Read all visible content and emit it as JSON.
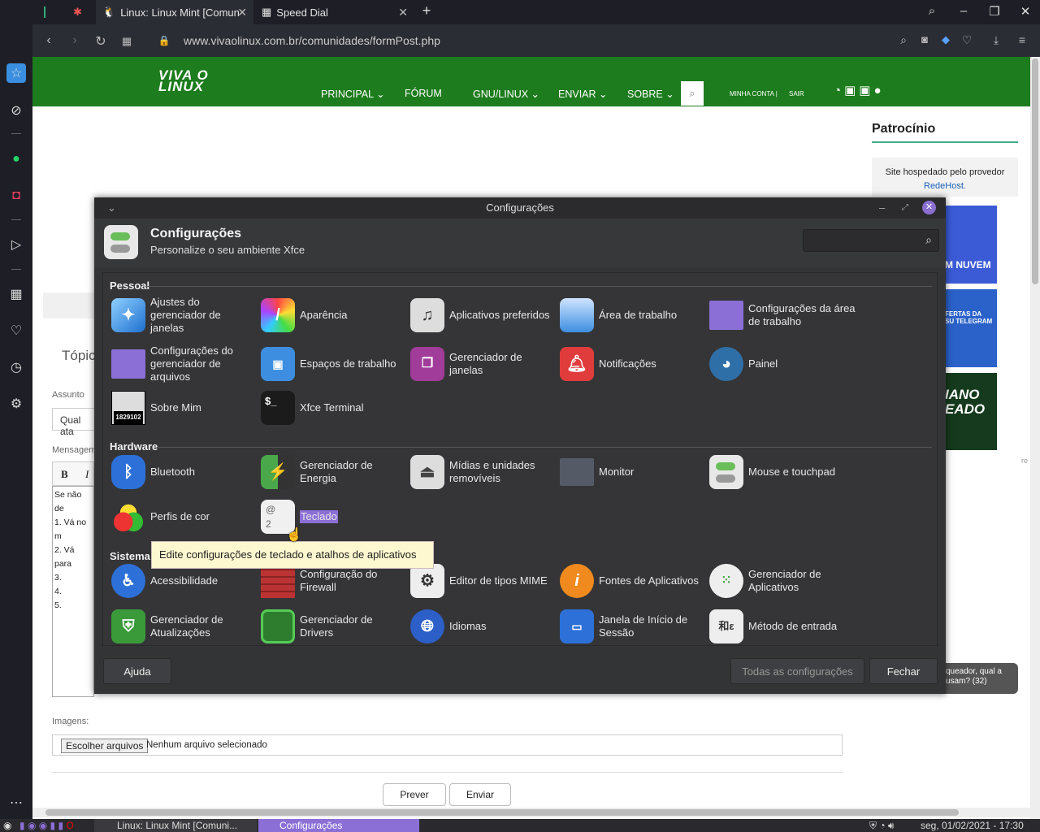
{
  "browser": {
    "tabs": [
      {
        "label": ""
      },
      {
        "label": ""
      },
      {
        "label": "Linux: Linux Mint [Comun"
      },
      {
        "label": "Speed Dial"
      }
    ],
    "new_tab": "+",
    "url": "www.vivaolinux.com.br/comunidades/formPost.php"
  },
  "site": {
    "logo_top": "VIVA O",
    "logo_bottom": "LINUX",
    "menu": [
      "PRINCIPAL ⌄",
      "FÓRUM",
      "GNU/LINUX ⌄",
      "ENVIAR ⌄",
      "SOBRE ⌄"
    ],
    "minha_conta": "MINHA CONTA |",
    "sair": "SAIR",
    "topicos": "Tópic",
    "assunto_label": "Assunto",
    "assunto_value": "Qual ata",
    "mensagem_label": "Mensagem",
    "msg_lines": [
      "Se não de",
      "1. Vá no m",
      "2. Vá para",
      "3.",
      "4.",
      "5."
    ],
    "bold": "B",
    "italic": "I",
    "imagens_label": "Imagens:",
    "choose_files": "Escolher arquivos",
    "no_file": "Nenhum arquivo selecionado",
    "prever": "Prever",
    "enviar": "Enviar",
    "patrocinio": "Patrocínio",
    "hosted_by": "Site hospedado pelo provedor",
    "redehost": "RedeHost.",
    "ad1": "M NUVEM",
    "ad2": "FERTAS DA\nSU TELEGRAM",
    "ad3": "IANO\nEADO",
    "side_q": "queador, qual a\nusam? (32)",
    "side_r": "re"
  },
  "dialog": {
    "window_title": "Configurações",
    "title": "Configurações",
    "subtitle": "Personalize o seu ambiente Xfce",
    "search_placeholder": "",
    "sections": [
      {
        "name": "Pessoal",
        "items": [
          "Ajustes do gerenciador de janelas",
          "Aparência",
          "Aplicativos preferidos",
          "Área de trabalho",
          "Configurações da área de trabalho",
          "Configurações do gerenciador de arquivos",
          "Espaços de trabalho",
          "Gerenciador de janelas",
          "Notificações",
          "Painel",
          "Sobre Mim",
          "Xfce Terminal"
        ]
      },
      {
        "name": "Hardware",
        "items": [
          "Bluetooth",
          "Gerenciador de Energia",
          "Mídias e unidades removíveis",
          "Monitor",
          "Mouse e touchpad",
          "Perfis de cor",
          "Teclado"
        ]
      },
      {
        "name": "Sistema",
        "items": [
          "Acessibilidade",
          "Configuração do Firewall",
          "Editor de tipos MIME",
          "Fontes de Aplicativos",
          "Gerenciador de Aplicativos",
          "Gerenciador de Atualizações",
          "Gerenciador de Drivers",
          "Idiomas",
          "Janela de Início de Sessão",
          "Método de entrada"
        ]
      }
    ],
    "sobre_mim_id": "1829102",
    "tooltip": "Edite configurações de teclado e atalhos de aplicativos",
    "help": "Ajuda",
    "all_settings": "Todas as configurações",
    "close": "Fechar"
  },
  "taskbar": {
    "win1": "Linux: Linux Mint [Comuni...",
    "win2": "Configurações",
    "clock": "seg, 01/02/2021 - 17:30"
  }
}
